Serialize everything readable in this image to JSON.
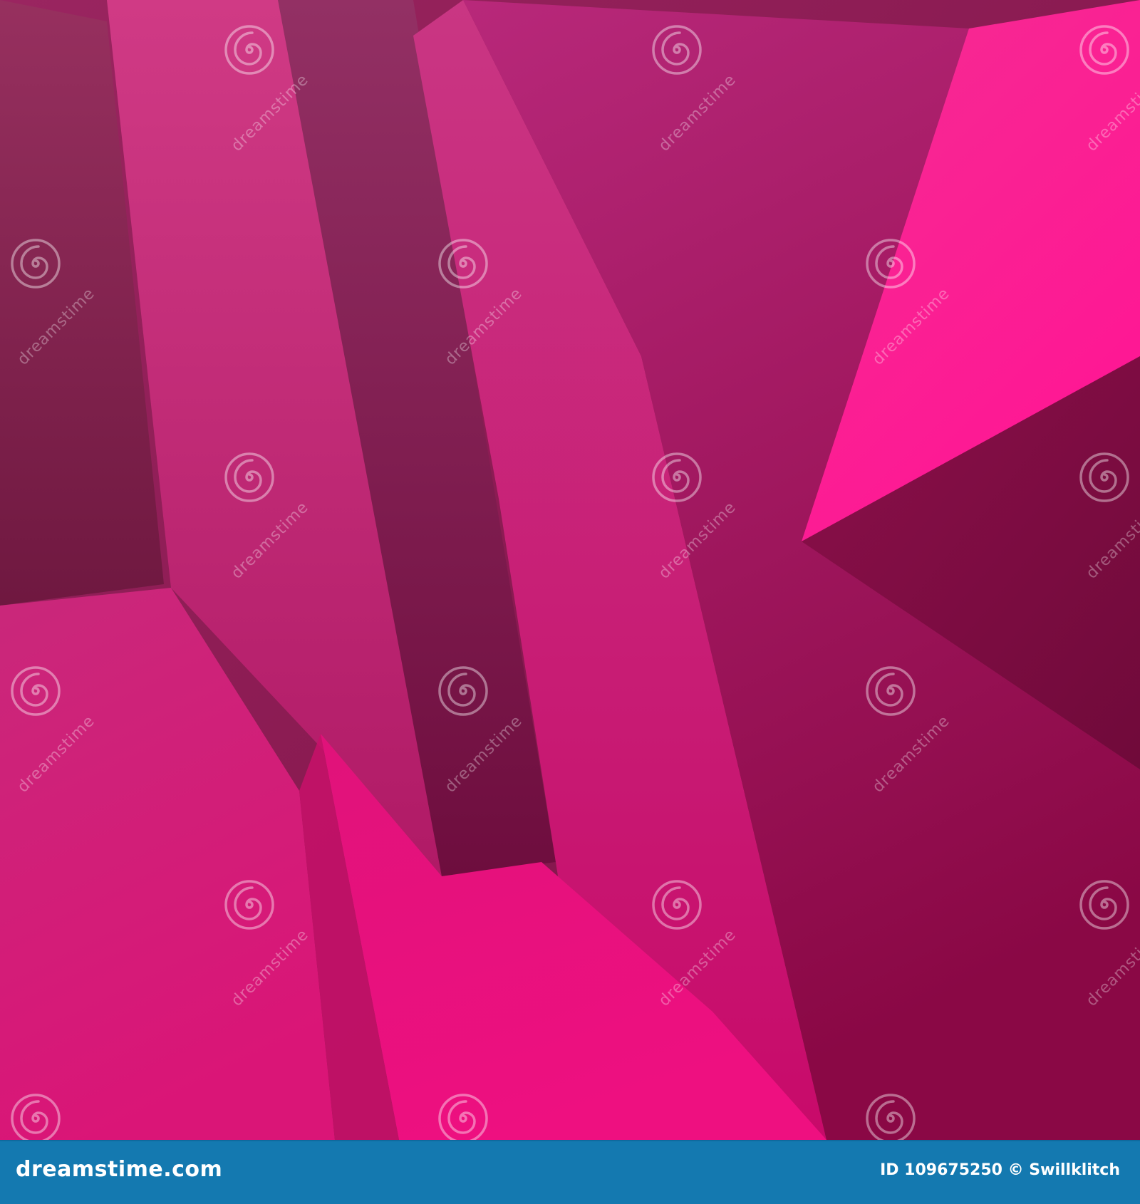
{
  "watermark": {
    "text": "dreamstime",
    "icon": "spiral-icon"
  },
  "footer": {
    "site": "dreamstime.com",
    "image_id": "ID 109675250 © Swillklitch",
    "bar_color": "#1479b0"
  },
  "colors": {
    "magenta_light": "#ff1a9a",
    "magenta_mid": "#c8236f",
    "magenta_dark": "#7a1043"
  }
}
